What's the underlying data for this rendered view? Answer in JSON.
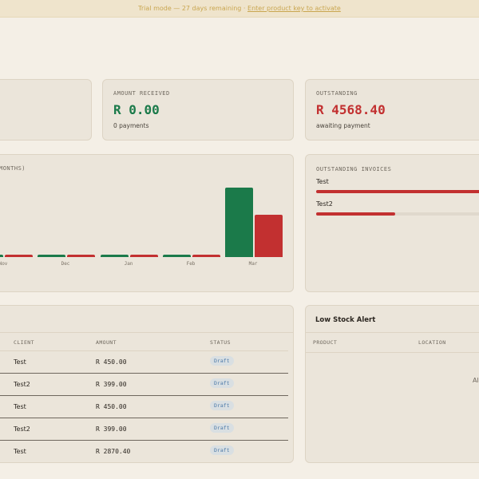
{
  "banner": {
    "text": "Trial mode — 27 days remaining  ·",
    "link": "Enter product key to activate"
  },
  "stats": [
    {
      "label": "AMOUNT RECEIVED",
      "value": "R 0.00",
      "sub": "0 payments",
      "color": "#1b7a4a"
    },
    {
      "label": "OUTSTANDING",
      "value": "R 4568.40",
      "sub": "awaiting payment",
      "color": "#c23030"
    }
  ],
  "chart_data": {
    "type": "bar",
    "title": "MONTHS)",
    "categories": [
      "Nov",
      "Dec",
      "Jan",
      "Feb",
      "Mar"
    ],
    "series": [
      {
        "color": "#1b7a4a",
        "values": [
          0,
          0,
          0,
          0,
          4568.4
        ]
      },
      {
        "color": "#c23030",
        "values": [
          0,
          0,
          0,
          0,
          2780
        ]
      }
    ],
    "ylim": [
      0,
      4568.4
    ],
    "grid": false
  },
  "outstanding": {
    "title": "OUTSTANDING INVOICES",
    "items": [
      {
        "name": "Test",
        "percent": 100
      },
      {
        "name": "Test2",
        "percent": 21
      }
    ]
  },
  "invoices": {
    "headers": [
      "CLIENT",
      "AMOUNT",
      "STATUS"
    ],
    "rows": [
      {
        "client": "Test",
        "amount": "R 450.00",
        "status": "Draft"
      },
      {
        "client": "Test2",
        "amount": "R 399.00",
        "status": "Draft"
      },
      {
        "client": "Test",
        "amount": "R 450.00",
        "status": "Draft"
      },
      {
        "client": "Test2",
        "amount": "R 399.00",
        "status": "Draft"
      },
      {
        "client": "Test",
        "amount": "R 2870.40",
        "status": "Draft"
      }
    ]
  },
  "low_stock": {
    "title": "Low Stock Alert",
    "headers": [
      "PRODUCT",
      "LOCATION"
    ],
    "empty": "All"
  }
}
